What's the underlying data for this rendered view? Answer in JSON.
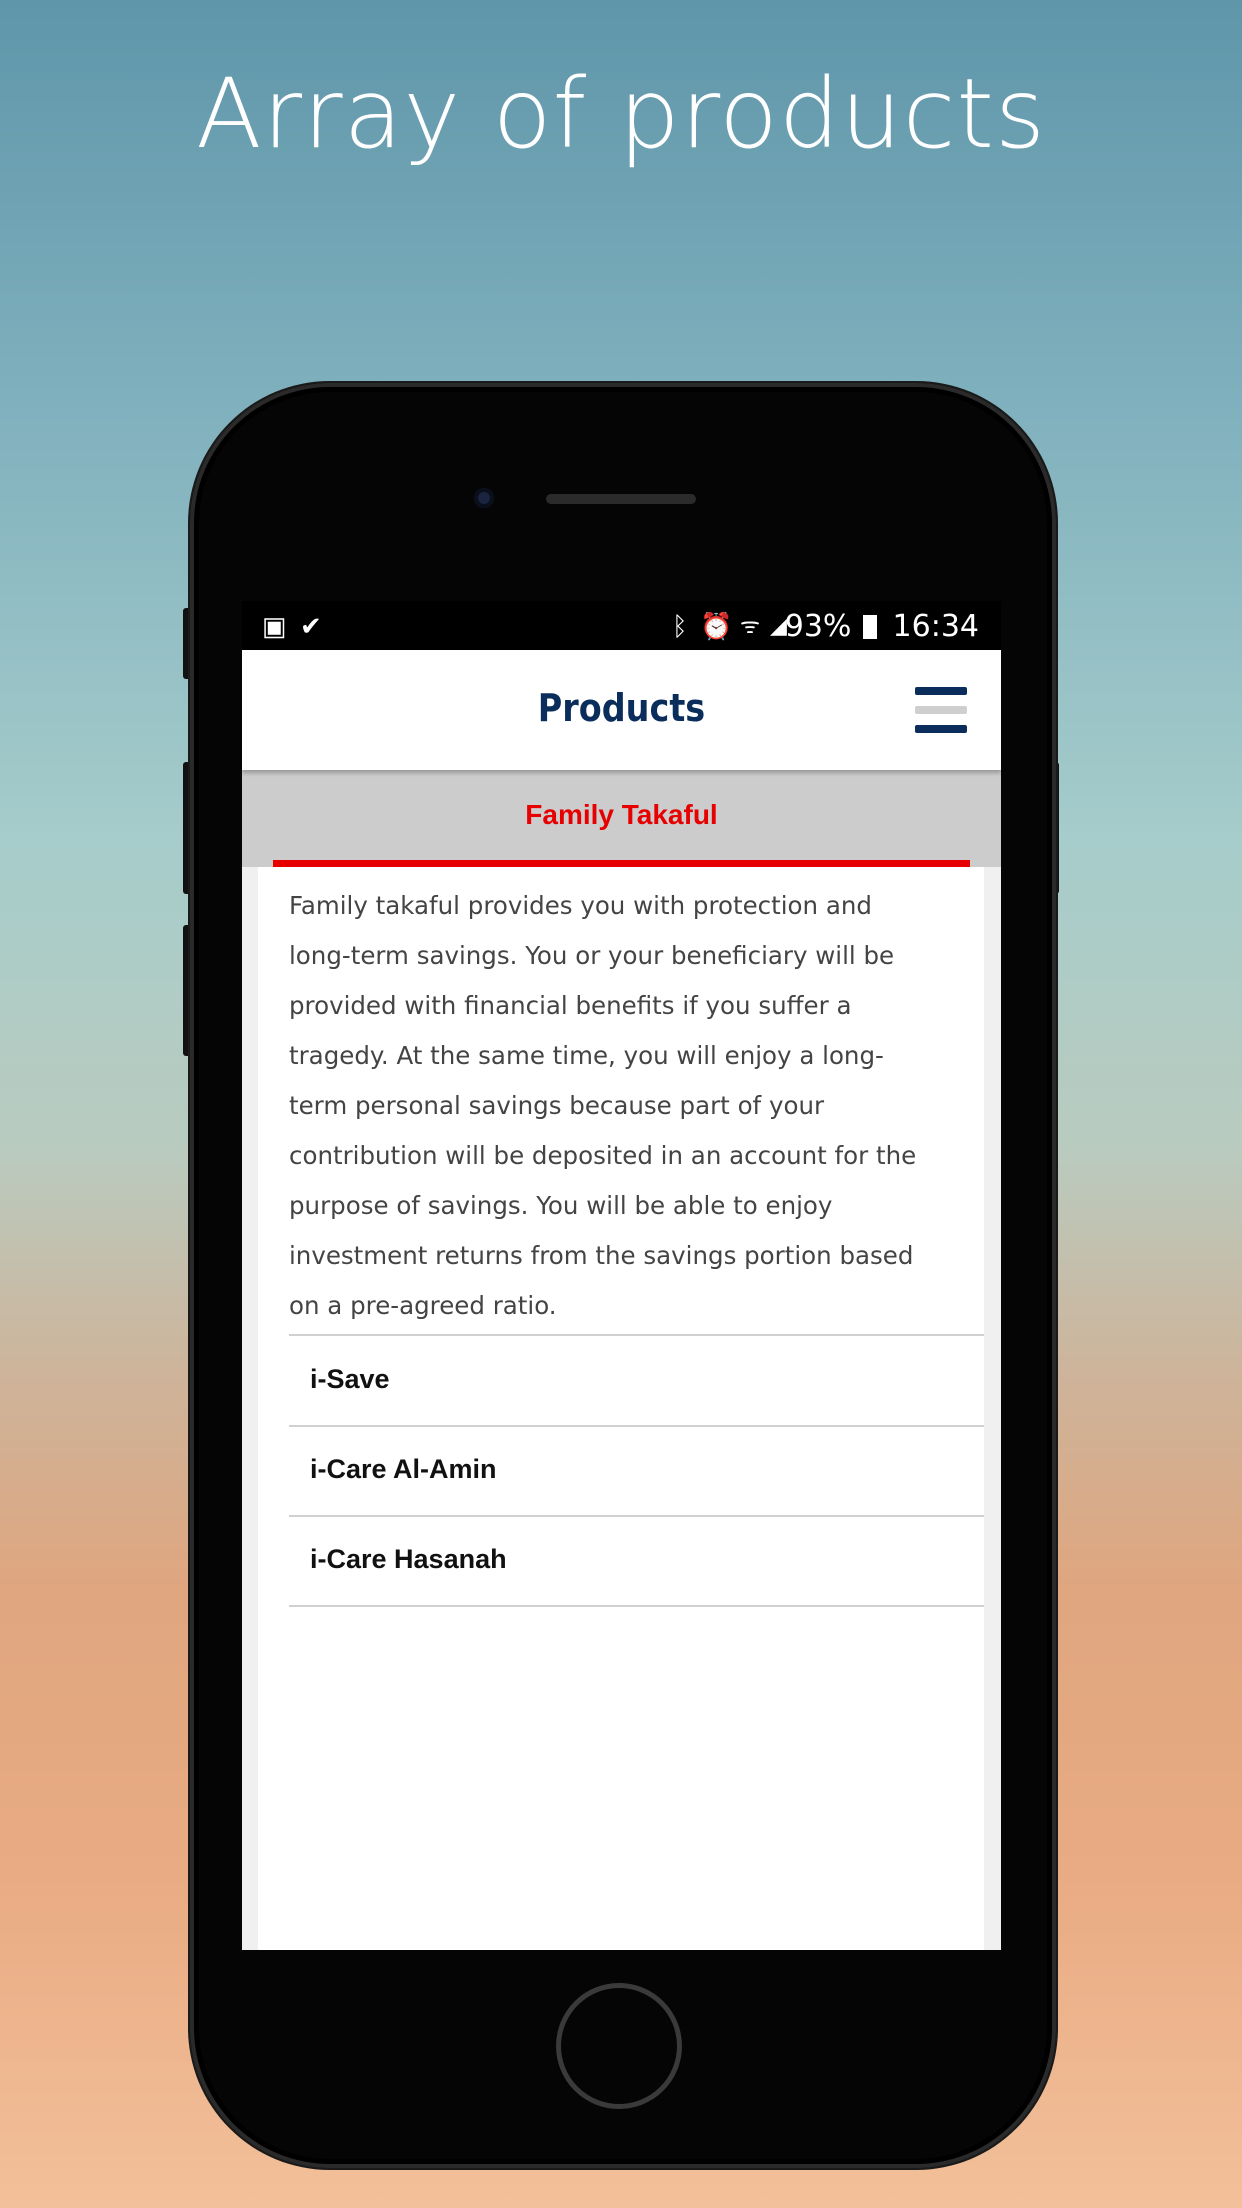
{
  "headline": "Array of products",
  "status_bar": {
    "left_icons": [
      "image-icon",
      "check-badge-icon"
    ],
    "right_icons": [
      "bluetooth-icon",
      "alarm-icon",
      "wifi-icon",
      "signal-icon"
    ],
    "battery": "93%",
    "time": "16:34"
  },
  "app_bar": {
    "title": "Products",
    "menu_icon": "hamburger-menu-icon"
  },
  "tab": {
    "label": "Family Takaful",
    "accent_color": "#e60000"
  },
  "description_lines": [
    "Family takaful provides you with protection and",
    "long-term savings. You or your beneficiary will be",
    "provided with financial benefits if you suffer a",
    "tragedy. At the same time, you will enjoy a long-",
    "term personal savings because part of your",
    "contribution will be deposited in an account for the",
    "purpose of savings. You will be able to enjoy",
    "investment returns from the savings portion based",
    "on a pre-agreed ratio."
  ],
  "products": [
    {
      "label": "i-Save"
    },
    {
      "label": "i-Care Al-Amin"
    },
    {
      "label": "i-Care Hasanah"
    }
  ],
  "fab": {
    "icon": "more-vertical-icon",
    "color": "#062c5f"
  },
  "brand_color": "#0b2d5c"
}
